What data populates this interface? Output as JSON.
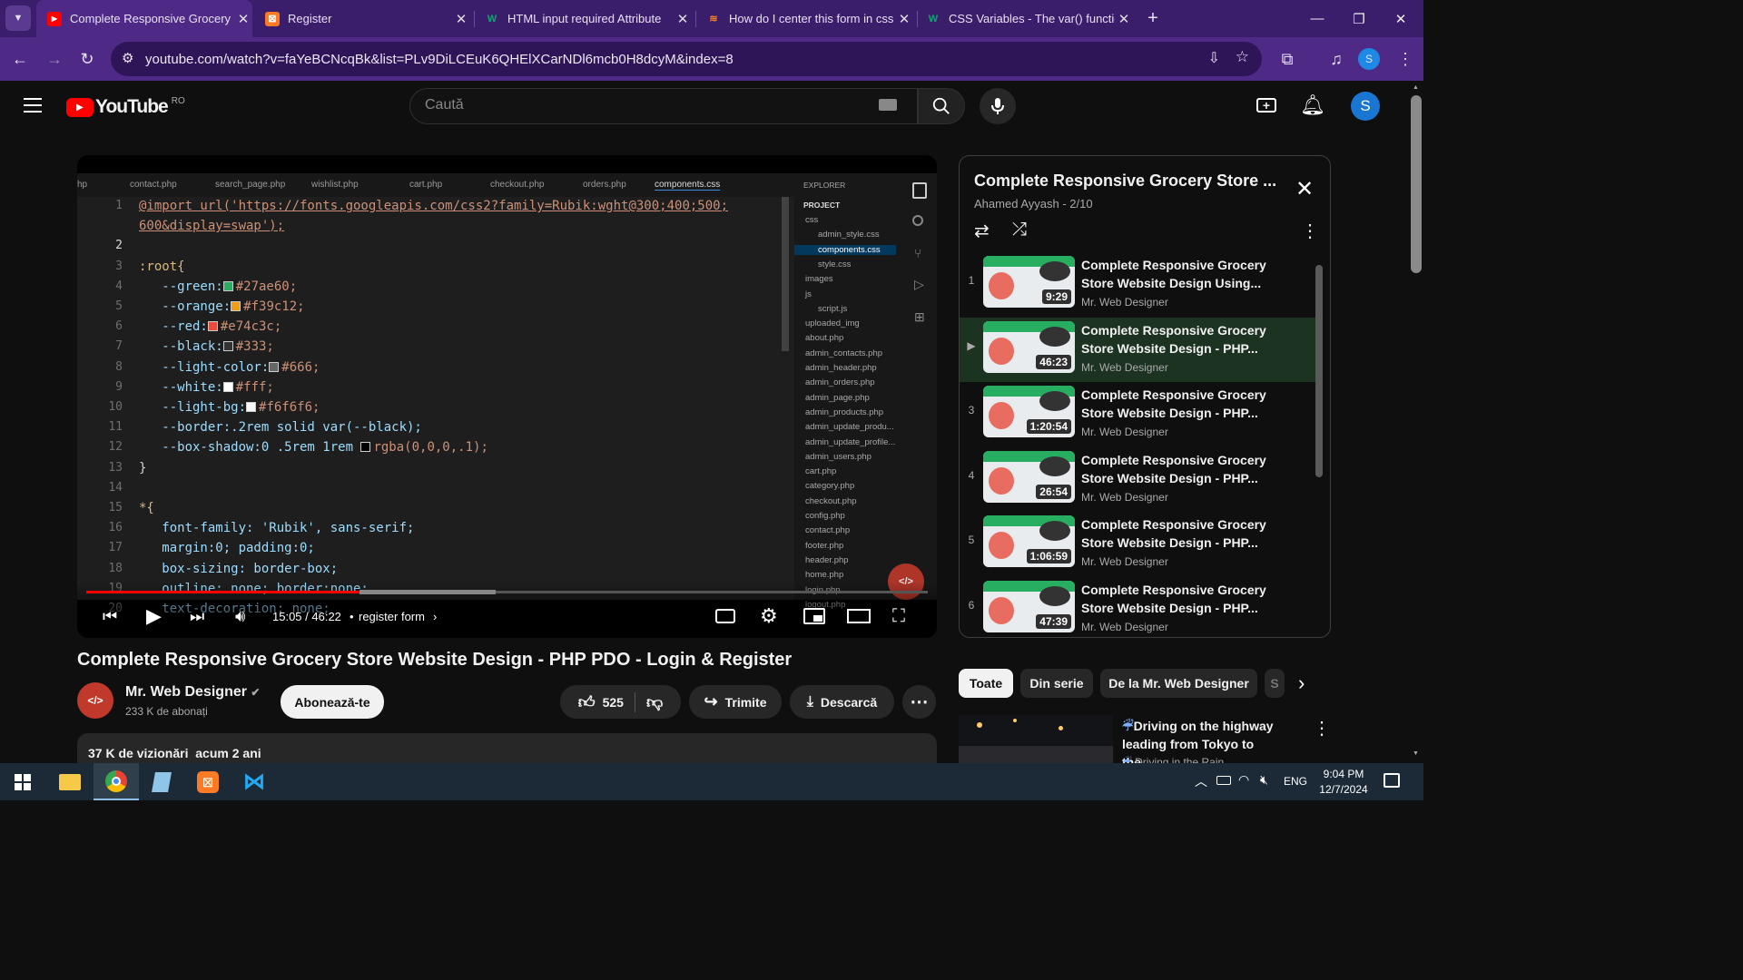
{
  "browser": {
    "tabs": [
      {
        "title": "Complete Responsive Grocery S",
        "active": true
      },
      {
        "title": "Register",
        "active": false
      },
      {
        "title": "HTML input required Attribute",
        "active": false
      },
      {
        "title": "How do I center this form in css",
        "active": false
      },
      {
        "title": "CSS Variables - The var() functic",
        "active": false
      }
    ],
    "url": "youtube.com/watch?v=faYeBCNcqBk&list=PLv9DiLCEuK6QHElXCarNDl6mcb0H8dcyM&index=8",
    "profile_initial": "S"
  },
  "youtube": {
    "logo_text": "YouTube",
    "region": "RO",
    "search_placeholder": "Caută",
    "avatar_initial": "S"
  },
  "editor": {
    "tabs": [
      "hp",
      "contact.php",
      "search_page.php",
      "wishlist.php",
      "cart.php",
      "checkout.php",
      "orders.php",
      "components.css"
    ],
    "explorer_title": "EXPLORER",
    "project_label": "PROJECT",
    "tree": [
      "css",
      "admin_style.css",
      "components.css",
      "style.css",
      "images",
      "js",
      "script.js",
      "uploaded_img",
      "about.php",
      "admin_contacts.php",
      "admin_header.php",
      "admin_orders.php",
      "admin_page.php",
      "admin_products.php",
      "admin_update_produ...",
      "admin_update_profile...",
      "admin_users.php",
      "cart.php",
      "category.php",
      "checkout.php",
      "config.php",
      "contact.php",
      "footer.php",
      "header.php",
      "home.php",
      "login.php",
      "logout.php"
    ],
    "lines": [
      {
        "n": "1",
        "t": "@import url('https://fonts.googleapis.com/css2?family=Rubik:wght@300;400;500;"
      },
      {
        "n": "",
        "t": "600&display=swap');"
      },
      {
        "n": "2",
        "t": ""
      },
      {
        "n": "3",
        "t": ":root{"
      },
      {
        "n": "4",
        "t": "   --green:",
        "v": "#27ae60;",
        "c": "#27ae60"
      },
      {
        "n": "5",
        "t": "   --orange:",
        "v": "#f39c12;",
        "c": "#f39c12"
      },
      {
        "n": "6",
        "t": "   --red:",
        "v": "#e74c3c;",
        "c": "#e74c3c"
      },
      {
        "n": "7",
        "t": "   --black:",
        "v": "#333;",
        "c": "#333333"
      },
      {
        "n": "8",
        "t": "   --light-color:",
        "v": "#666;",
        "c": "#666666"
      },
      {
        "n": "9",
        "t": "   --white:",
        "v": "#fff;",
        "c": "#ffffff"
      },
      {
        "n": "10",
        "t": "   --light-bg:",
        "v": "#f6f6f6;",
        "c": "#f6f6f6"
      },
      {
        "n": "11",
        "t": "   --border:.2rem solid var(--black);"
      },
      {
        "n": "12",
        "t": "   --box-shadow:0 .5rem 1rem ",
        "v": "rgba(0,0,0,.1);",
        "c": "#000000"
      },
      {
        "n": "13",
        "t": "}"
      },
      {
        "n": "14",
        "t": ""
      },
      {
        "n": "15",
        "t": "*{"
      },
      {
        "n": "16",
        "t": "   font-family: 'Rubik', sans-serif;"
      },
      {
        "n": "17",
        "t": "   margin:0; padding:0;"
      },
      {
        "n": "18",
        "t": "   box-sizing: border-box;"
      },
      {
        "n": "19",
        "t": "   outline: none; border:none;"
      },
      {
        "n": "20",
        "t": "   text-decoration: none;"
      }
    ]
  },
  "player": {
    "time": "15:05 / 46:22",
    "chapter": "register form",
    "progress": 0.325
  },
  "video": {
    "title": "Complete Responsive Grocery Store Website Design - PHP PDO - Login & Register",
    "channel": "Mr. Web Designer",
    "subscribers": "233 K de abonați",
    "subscribe_label": "Abonează-te",
    "likes": "525",
    "share_label": "Trimite",
    "download_label": "Descarcă",
    "views": "37 K de vizionări",
    "age": "acum 2 ani"
  },
  "playlist": {
    "title": "Complete Responsive Grocery Store ...",
    "subtitle": "Ahamed Ayyash - 2/10",
    "items": [
      {
        "index": "1",
        "title": "Complete Responsive Grocery Store Website Design Using...",
        "channel": "Mr. Web Designer",
        "duration": "9:29",
        "current": false
      },
      {
        "index": "▶",
        "title": "Complete Responsive Grocery Store Website Design - PHP...",
        "channel": "Mr. Web Designer",
        "duration": "46:23",
        "current": true
      },
      {
        "index": "3",
        "title": "Complete Responsive Grocery Store Website Design - PHP...",
        "channel": "Mr. Web Designer",
        "duration": "1:20:54",
        "current": false
      },
      {
        "index": "4",
        "title": "Complete Responsive Grocery Store Website Design - PHP...",
        "channel": "Mr. Web Designer",
        "duration": "26:54",
        "current": false
      },
      {
        "index": "5",
        "title": "Complete Responsive Grocery Store Website Design - PHP...",
        "channel": "Mr. Web Designer",
        "duration": "1:06:59",
        "current": false
      },
      {
        "index": "6",
        "title": "Complete Responsive Grocery Store Website Design - PHP...",
        "channel": "Mr. Web Designer",
        "duration": "47:39",
        "current": false
      }
    ]
  },
  "chips": [
    "Toate",
    "Din serie",
    "De la Mr. Web Designer",
    "S"
  ],
  "recommended": {
    "title": "Driving on the highway leading from Tokyo to the...",
    "channel": "Driving in the Rain"
  },
  "taskbar": {
    "lang": "ENG",
    "time": "9:04 PM",
    "date": "12/7/2024"
  }
}
